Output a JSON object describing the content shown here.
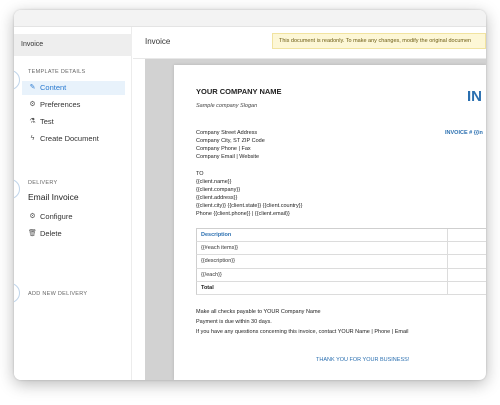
{
  "sidebar": {
    "title": "Invoice",
    "template_details_label": "TEMPLATE DETAILS",
    "template_items": [
      {
        "label": "Content",
        "icon": "pencil-icon"
      },
      {
        "label": "Preferences",
        "icon": "gear-icon"
      },
      {
        "label": "Test",
        "icon": "flask-icon"
      },
      {
        "label": "Create Document",
        "icon": "lightning-icon"
      }
    ],
    "delivery_label": "DELIVERY",
    "delivery_name": "Email Invoice",
    "delivery_items": [
      {
        "label": "Configure",
        "icon": "gear-icon"
      },
      {
        "label": "Delete",
        "icon": "trash-icon"
      }
    ],
    "add_delivery_label": "ADD NEW DELIVERY"
  },
  "main": {
    "title": "Invoice",
    "readonly_notice": "This document is readonly. To make any changes, modify the original documen"
  },
  "document": {
    "company_name": "YOUR COMPANY NAME",
    "slogan": "Sample company Slogan",
    "invoice_heading": "IN",
    "invoice_number": "INVOICE # {{in",
    "address_lines": [
      "Company Street Address",
      "Company City, ST ZIP Code",
      "Company Phone  |  Fax",
      "Company Email  |  Website"
    ],
    "to_label": "TO",
    "client_lines": [
      "{{client.name}}",
      "{{client.company}}",
      "{{client.address}}",
      "{{client.city}} {{client.state}} {{client.country}}",
      "Phone {{client.phone}} | {{client.email}}"
    ],
    "table": {
      "header": "Description",
      "rows": [
        "{{#each items}}",
        "{{description}}",
        "{{/each}}"
      ],
      "total_label": "Total"
    },
    "footer_lines": [
      "Make all checks payable to YOUR Company Name",
      "Payment is due within 30 days.",
      "If you have any questions concerning this invoice, contact YOUR Name  |  Phone  |  Email"
    ],
    "thanks": "THANK YOU FOR YOUR BUSINESS!"
  },
  "colors": {
    "accent": "#2a7ad0",
    "invoice_blue": "#2a6fb0",
    "notice_bg": "#fdf7d6",
    "canvas_bg": "#d2d2d2"
  }
}
